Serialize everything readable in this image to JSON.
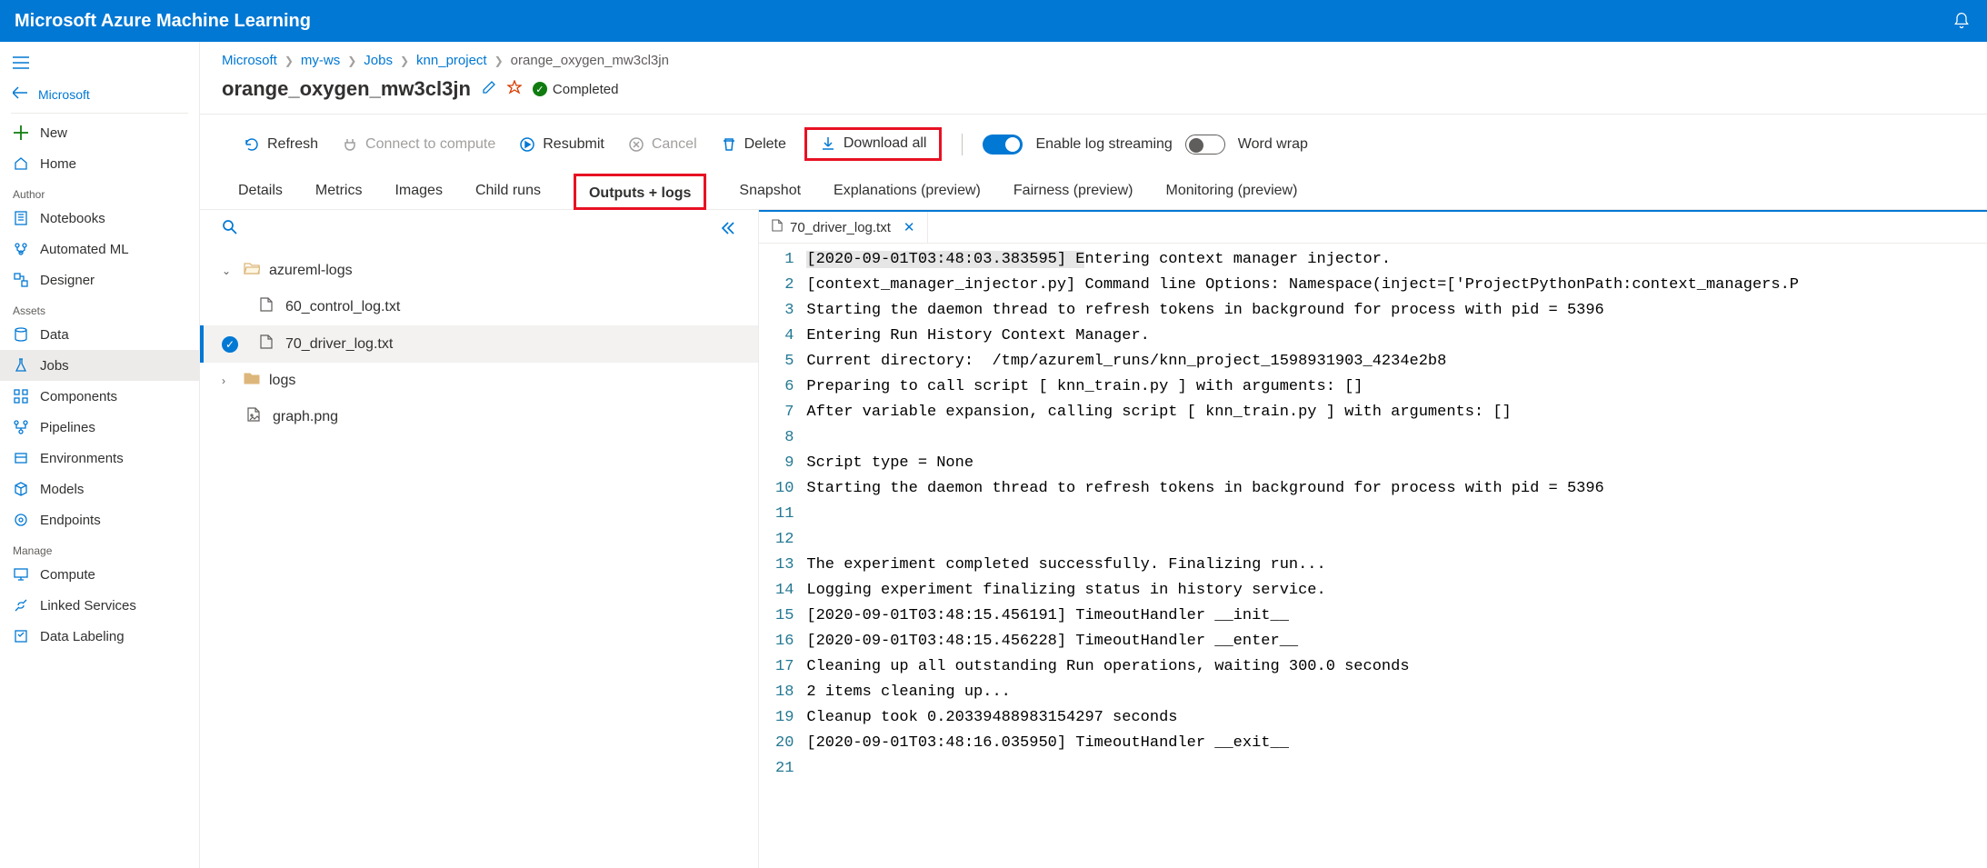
{
  "app_title": "Microsoft Azure Machine Learning",
  "left_nav": {
    "back_label": "Microsoft",
    "new": "New",
    "home": "Home",
    "section_author": "Author",
    "notebooks": "Notebooks",
    "automl": "Automated ML",
    "designer": "Designer",
    "section_assets": "Assets",
    "data": "Data",
    "jobs": "Jobs",
    "components": "Components",
    "pipelines": "Pipelines",
    "environments": "Environments",
    "models": "Models",
    "endpoints": "Endpoints",
    "section_manage": "Manage",
    "compute": "Compute",
    "linked_services": "Linked Services",
    "data_labeling": "Data Labeling"
  },
  "breadcrumb": {
    "items": [
      "Microsoft",
      "my-ws",
      "Jobs",
      "knn_project",
      "orange_oxygen_mw3cl3jn"
    ]
  },
  "job": {
    "title": "orange_oxygen_mw3cl3jn",
    "status": "Completed"
  },
  "toolbar": {
    "refresh": "Refresh",
    "connect": "Connect to compute",
    "resubmit": "Resubmit",
    "cancel": "Cancel",
    "delete": "Delete",
    "download_all": "Download all",
    "enable_log_streaming": "Enable log streaming",
    "word_wrap": "Word wrap"
  },
  "tabs": [
    "Details",
    "Metrics",
    "Images",
    "Child runs",
    "Outputs + logs",
    "Snapshot",
    "Explanations (preview)",
    "Fairness (preview)",
    "Monitoring (preview)"
  ],
  "active_tab": "Outputs + logs",
  "file_tree": {
    "folders": [
      {
        "name": "azureml-logs",
        "expanded": true,
        "files": [
          "60_control_log.txt",
          "70_driver_log.txt"
        ],
        "selected_file": "70_driver_log.txt"
      },
      {
        "name": "logs",
        "expanded": false,
        "files": []
      }
    ],
    "loose_files": [
      "graph.png"
    ]
  },
  "editor": {
    "open_tab": "70_driver_log.txt",
    "lines": [
      "[2020-09-01T03:48:03.383595] Entering context manager injector.",
      "[context_manager_injector.py] Command line Options: Namespace(inject=['ProjectPythonPath:context_managers.P",
      "Starting the daemon thread to refresh tokens in background for process with pid = 5396",
      "Entering Run History Context Manager.",
      "Current directory:  /tmp/azureml_runs/knn_project_1598931903_4234e2b8",
      "Preparing to call script [ knn_train.py ] with arguments: []",
      "After variable expansion, calling script [ knn_train.py ] with arguments: []",
      "",
      "Script type = None",
      "Starting the daemon thread to refresh tokens in background for process with pid = 5396",
      "",
      "",
      "The experiment completed successfully. Finalizing run...",
      "Logging experiment finalizing status in history service.",
      "[2020-09-01T03:48:15.456191] TimeoutHandler __init__",
      "[2020-09-01T03:48:15.456228] TimeoutHandler __enter__",
      "Cleaning up all outstanding Run operations, waiting 300.0 seconds",
      "2 items cleaning up...",
      "Cleanup took 0.20339488983154297 seconds",
      "[2020-09-01T03:48:16.035950] TimeoutHandler __exit__",
      ""
    ]
  }
}
